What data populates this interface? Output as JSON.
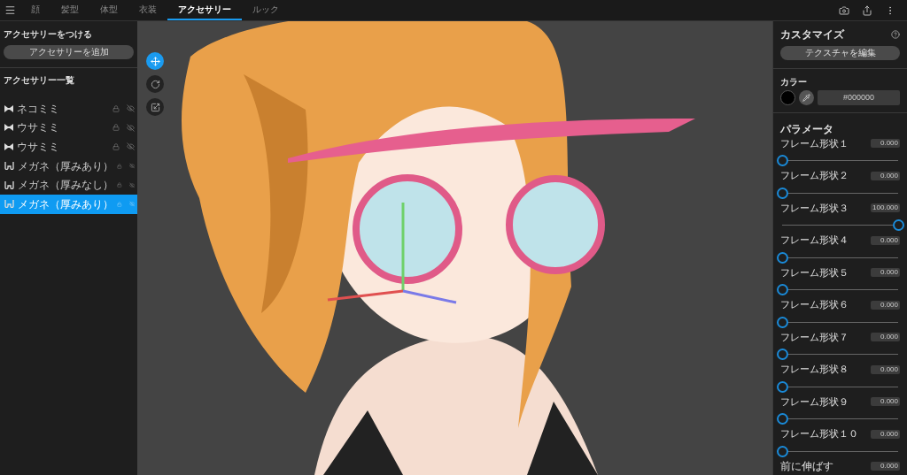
{
  "tabs": [
    {
      "label": "顔",
      "selected": false
    },
    {
      "label": "髪型",
      "selected": false
    },
    {
      "label": "体型",
      "selected": false
    },
    {
      "label": "衣装",
      "selected": false
    },
    {
      "label": "アクセサリー",
      "selected": true
    },
    {
      "label": "ルック",
      "selected": false
    }
  ],
  "left_panel": {
    "attach_title": "アクセサリーをつける",
    "add_button": "アクセサリーを追加",
    "list_title": "アクセサリー一覧",
    "items": [
      {
        "kind": "ears",
        "label": "ネコミミ",
        "selected": false
      },
      {
        "kind": "ears",
        "label": "ウサミミ",
        "selected": false
      },
      {
        "kind": "ears",
        "label": "ウサミミ",
        "selected": false
      },
      {
        "kind": "glasses",
        "label": "メガネ（厚みあり）",
        "selected": false
      },
      {
        "kind": "glasses",
        "label": "メガネ（厚みなし）",
        "selected": false
      },
      {
        "kind": "glasses",
        "label": "メガネ（厚みあり）",
        "selected": true
      }
    ]
  },
  "viewport": {
    "kind": "picture",
    "tools": [
      {
        "kind": "move",
        "selected": true
      },
      {
        "kind": "rotate",
        "selected": false
      },
      {
        "kind": "scale",
        "selected": false
      }
    ]
  },
  "right_panel": {
    "customize_title": "カスタマイズ",
    "edit_texture_button": "テクスチャを編集",
    "color_title": "カラー",
    "color_value": "#000000",
    "color": "#000000",
    "params_title": "パラメータ",
    "sliders": [
      {
        "label": "フレーム形状１",
        "value": "0.000",
        "level": 0
      },
      {
        "label": "フレーム形状２",
        "value": "0.000",
        "level": 0
      },
      {
        "label": "フレーム形状３",
        "value": "100.000",
        "level": 1
      },
      {
        "label": "フレーム形状４",
        "value": "0.000",
        "level": 0
      },
      {
        "label": "フレーム形状５",
        "value": "0.000",
        "level": 0
      },
      {
        "label": "フレーム形状６",
        "value": "0.000",
        "level": 0
      },
      {
        "label": "フレーム形状７",
        "value": "0.000",
        "level": 0
      },
      {
        "label": "フレーム形状８",
        "value": "0.000",
        "level": 0
      },
      {
        "label": "フレーム形状９",
        "value": "0.000",
        "level": 0
      },
      {
        "label": "フレーム形状１０",
        "value": "0.000",
        "level": 0
      },
      {
        "label": "前に伸ばす",
        "value": "0.000"
      }
    ]
  }
}
